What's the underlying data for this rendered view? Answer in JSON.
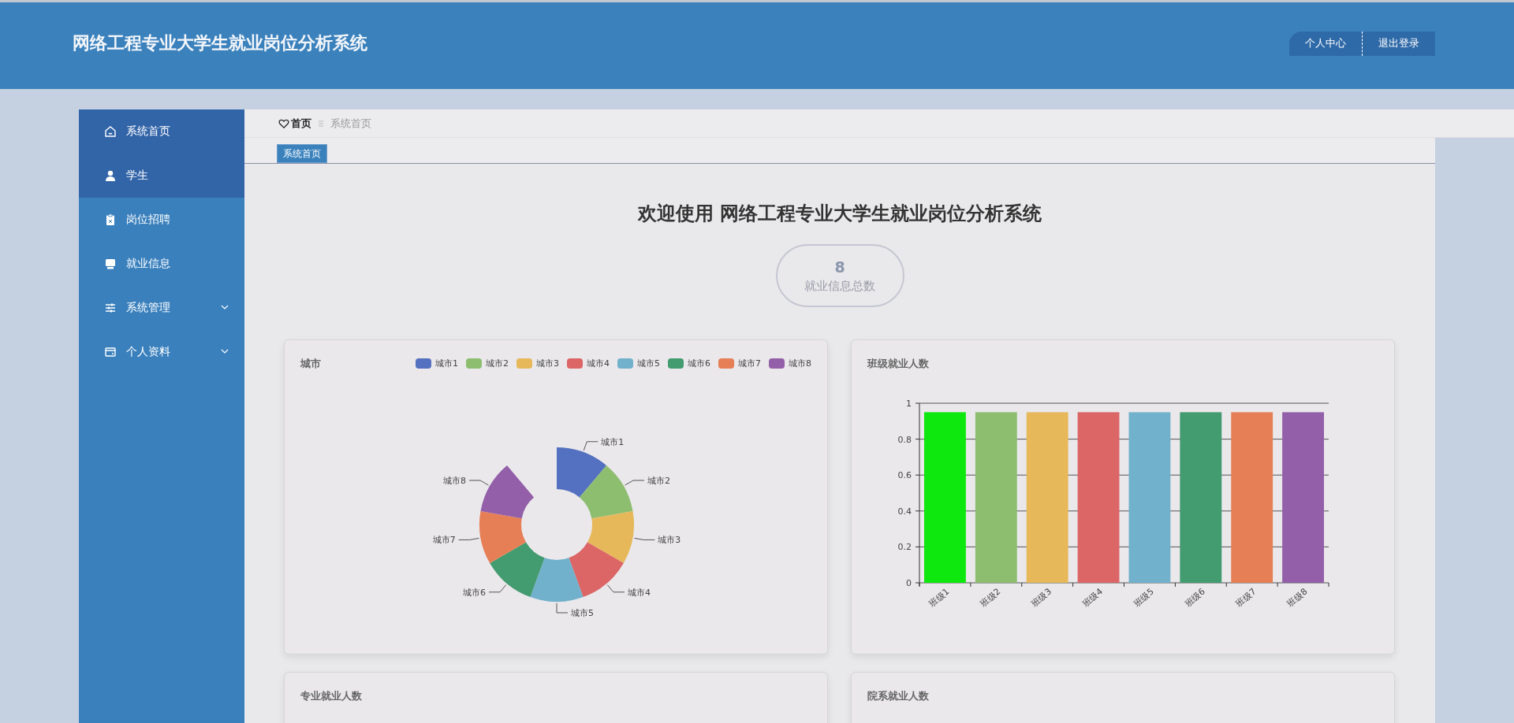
{
  "header": {
    "title": "网络工程专业大学生就业岗位分析系统",
    "buttons": [
      "个人中心",
      "退出登录"
    ]
  },
  "sidebar": {
    "items": [
      {
        "label": "系统首页",
        "selected": true
      },
      {
        "label": "学生",
        "selected": true
      },
      {
        "label": "岗位招聘",
        "selected": false
      },
      {
        "label": "就业信息",
        "selected": false
      },
      {
        "label": "系统管理",
        "selected": false,
        "expanded": false
      },
      {
        "label": "个人资料",
        "selected": false,
        "expanded": false
      }
    ]
  },
  "breadcrumb": {
    "items": [
      "首页",
      "系统首页"
    ]
  },
  "tabs": [
    {
      "label": "系统首页",
      "selected": true
    }
  ],
  "welcome": {
    "title": "欢迎使用 网络工程专业大学生就业岗位分析系统"
  },
  "stat": {
    "value": "8",
    "label": "就业信息总数"
  },
  "cards": [
    {
      "title": "城市",
      "legend": [
        {
          "label": "城市1",
          "color": "#5470c0"
        },
        {
          "label": "城市2",
          "color": "#8dbe70"
        },
        {
          "label": "城市3",
          "color": "#e6b85a"
        },
        {
          "label": "城市4",
          "color": "#dc6566"
        },
        {
          "label": "城市5",
          "color": "#72b1cc"
        },
        {
          "label": "城市6",
          "color": "#439b70"
        },
        {
          "label": "城市7",
          "color": "#e67f56"
        },
        {
          "label": "城市8",
          "color": "#925fa8"
        }
      ],
      "chart_data": {
        "type": "donut",
        "categories": [
          "城市1",
          "城市2",
          "城市3",
          "城市4",
          "城市5",
          "城市6",
          "城市7",
          "城市8"
        ],
        "values": [
          1,
          1,
          1,
          1,
          1,
          1,
          1,
          1
        ]
      }
    },
    {
      "title": "班级就业人数",
      "bars": [
        {
          "color": "#0ee80e"
        },
        {
          "color": "#8dbe70"
        },
        {
          "color": "#e6b85a"
        },
        {
          "color": "#dc6566"
        },
        {
          "color": "#72b1cc"
        },
        {
          "color": "#439b70"
        },
        {
          "color": "#e67f56"
        },
        {
          "color": "#925fa8"
        }
      ],
      "chart_data": {
        "type": "bar",
        "categories": [
          "班级1",
          "班级2",
          "班级3",
          "班级4",
          "班级5",
          "班级6",
          "班级7",
          "班级8"
        ],
        "values": [
          0.95,
          0.95,
          0.95,
          0.95,
          0.95,
          0.95,
          0.95,
          0.95
        ],
        "ylim": [
          0,
          1
        ],
        "yticks": [
          0,
          0.2,
          0.4,
          0.6,
          0.8,
          1
        ],
        "grid": true
      }
    },
    {
      "title": "专业就业人数"
    },
    {
      "title": "院系就业人数"
    }
  ]
}
